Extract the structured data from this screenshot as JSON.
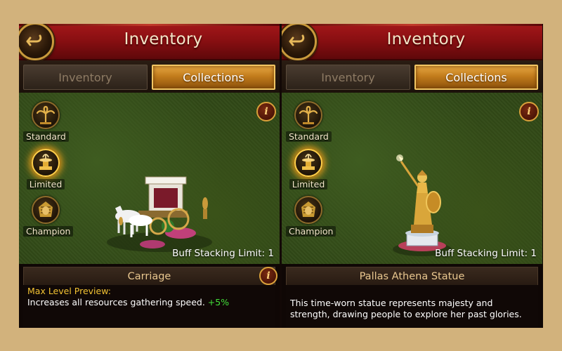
{
  "panels": [
    {
      "title": "Inventory",
      "tabs": [
        {
          "label": "Inventory",
          "active": false
        },
        {
          "label": "Collections",
          "active": true
        }
      ],
      "categories": [
        {
          "label": "Standard",
          "icon": "palm-tree-icon",
          "active": false
        },
        {
          "label": "Limited",
          "icon": "fountain-icon",
          "active": true
        },
        {
          "label": "Champion",
          "icon": "pharaoh-icon",
          "active": false
        }
      ],
      "buff_limit": "Buff Stacking Limit: 1",
      "item_name": "Carriage",
      "item_art": "carriage-icon",
      "description": {
        "title": "Max Level Preview:",
        "line": "Increases all resources gathering speed.",
        "bonus": "+5%"
      }
    },
    {
      "title": "Inventory",
      "tabs": [
        {
          "label": "Inventory",
          "active": false
        },
        {
          "label": "Collections",
          "active": true
        }
      ],
      "categories": [
        {
          "label": "Standard",
          "icon": "palm-tree-icon",
          "active": false
        },
        {
          "label": "Limited",
          "icon": "fountain-icon",
          "active": true
        },
        {
          "label": "Champion",
          "icon": "pharaoh-icon",
          "active": false
        }
      ],
      "buff_limit": "Buff Stacking Limit: 1",
      "item_name": "Pallas Athena Statue",
      "item_art": "athena-statue-icon",
      "description": {
        "text": "This time-worn statue represents majesty and strength, drawing people to explore her past glories."
      }
    }
  ],
  "colors": {
    "background": "#d2b27c",
    "title_bar": "#8a0f12",
    "tab_active": "#c27c1c",
    "bonus_green": "#43e03a",
    "desc_title_yellow": "#f2c233"
  }
}
